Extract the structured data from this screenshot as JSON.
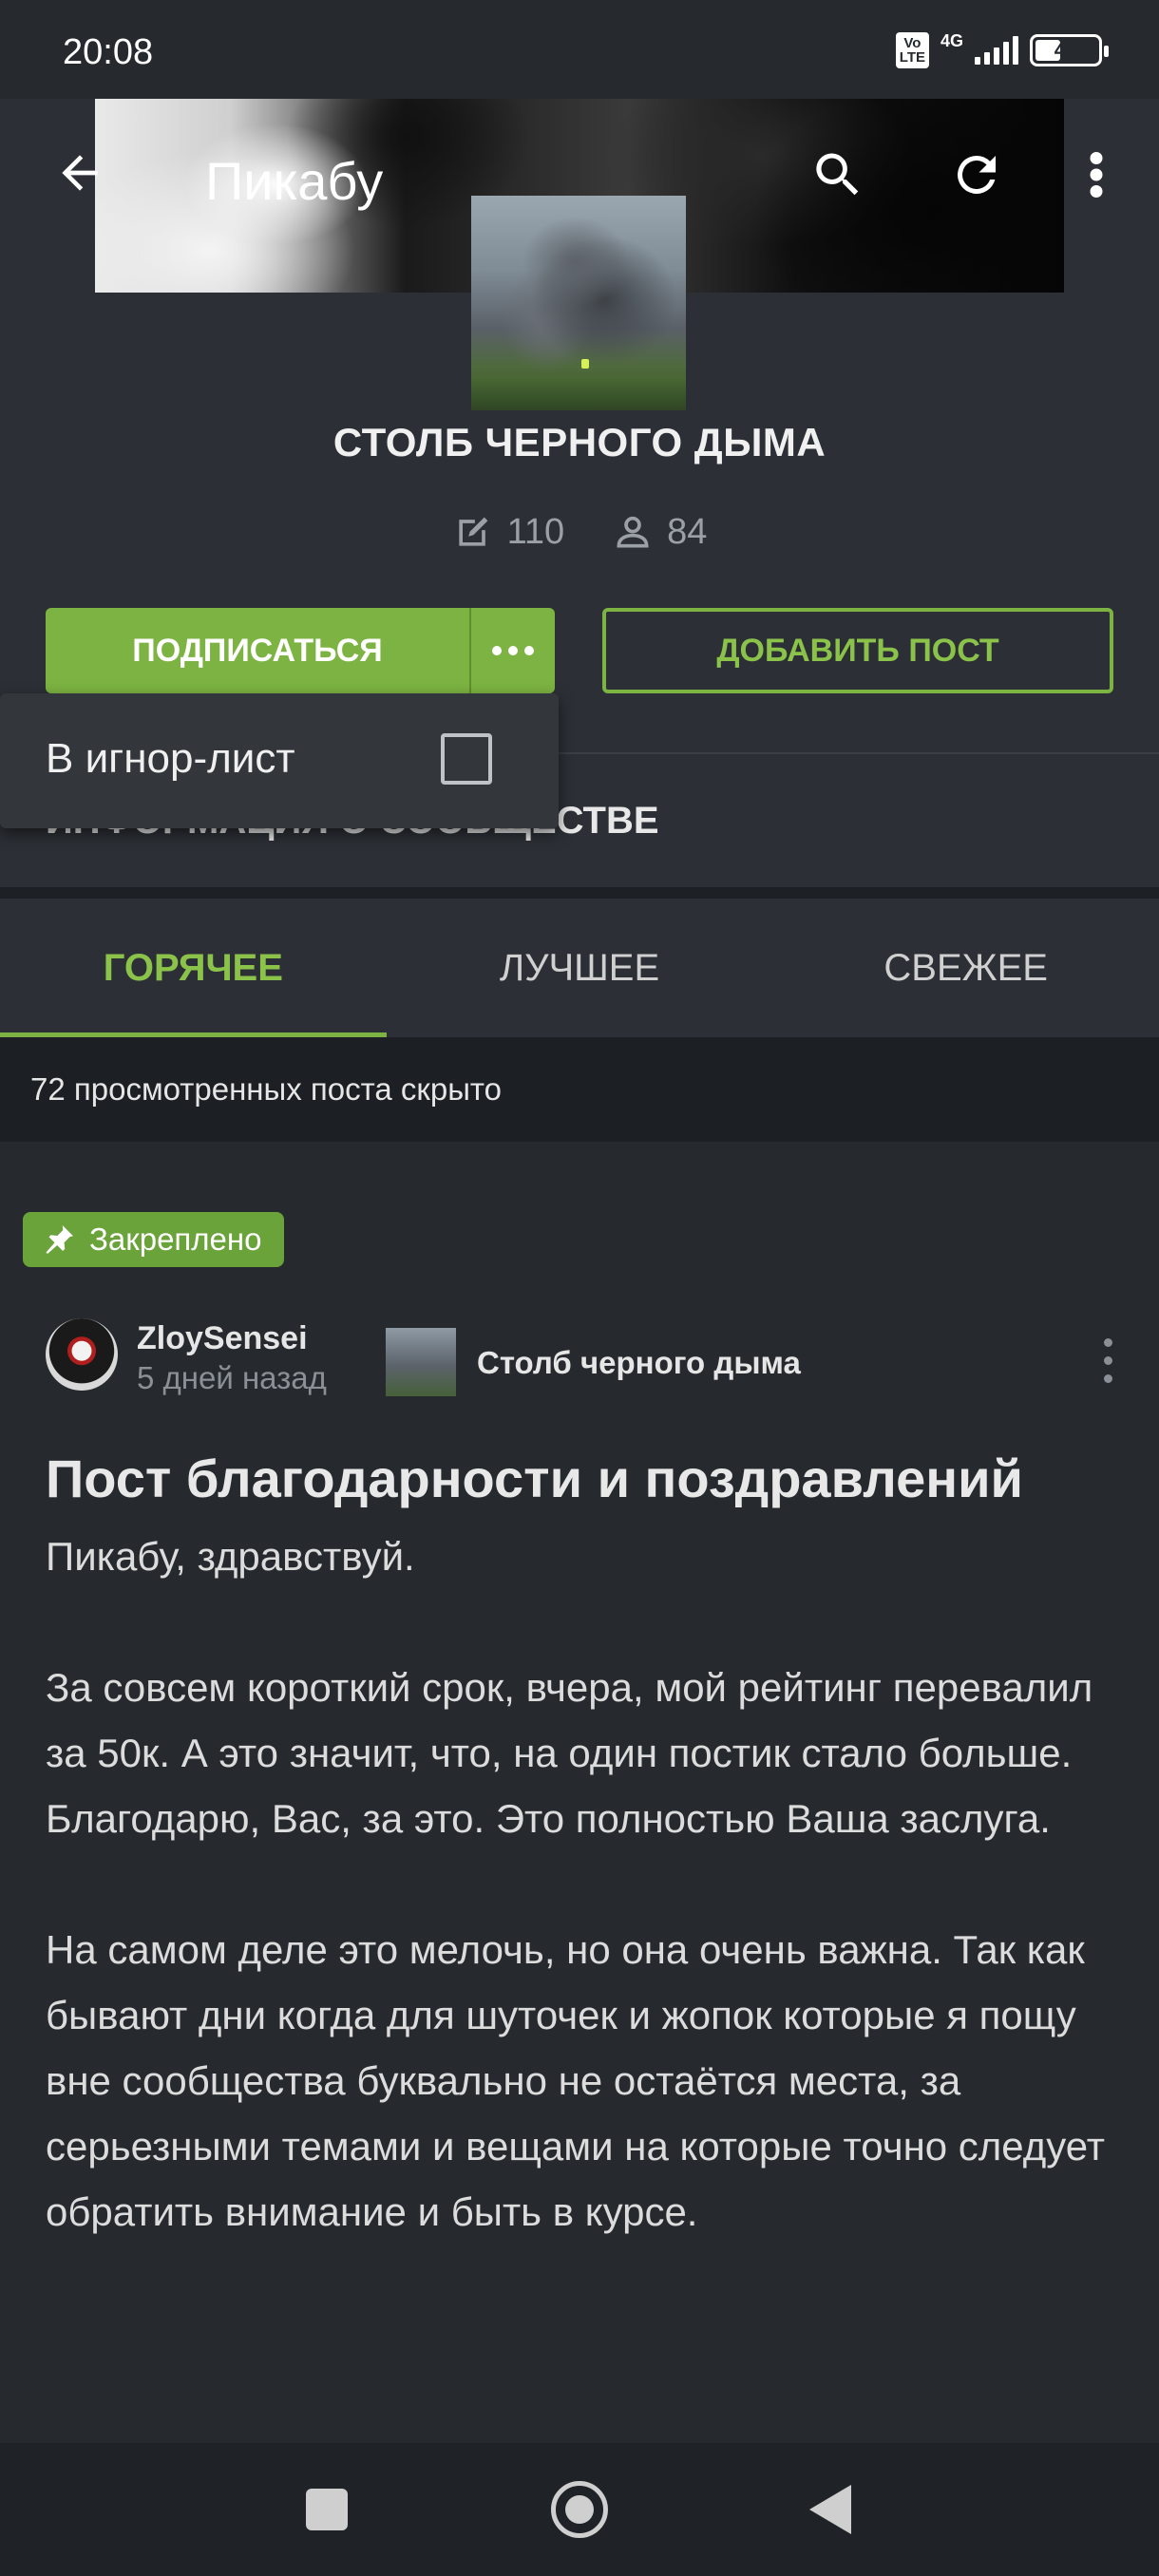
{
  "status_bar": {
    "time": "20:08",
    "volte_label": "Vo\nLTE",
    "network": "4G",
    "battery": "46",
    "battery_level": 0.46
  },
  "toolbar": {
    "title": "Пикабу",
    "back_icon": "arrow-left-icon",
    "search_icon": "search-icon",
    "refresh_icon": "refresh-icon",
    "more_icon": "more-vertical-icon"
  },
  "community": {
    "name": "СТОЛБ ЧЕРНОГО ДЫМА",
    "posts_count": "110",
    "subscribers_count": "84",
    "subscribe_label": "ПОДПИСАТЬСЯ",
    "add_post_label": "ДОБАВИТЬ ПОСТ",
    "info_label": "ИНФОРМАЦИЯ О СООБЩЕСТВЕ"
  },
  "popup": {
    "ignore_label": "В игнор-лист",
    "checked": false
  },
  "tabs": [
    {
      "label": "ГОРЯЧЕЕ",
      "active": true
    },
    {
      "label": "ЛУЧШЕЕ",
      "active": false
    },
    {
      "label": "СВЕЖЕЕ",
      "active": false
    }
  ],
  "hidden_notice": "72 просмотренных поста скрыто",
  "post": {
    "pinned_label": "Закреплено",
    "author": "ZloySensei",
    "time": "5 дней назад",
    "community": "Столб черного дыма",
    "title": "Пост благодарности и поздравлений",
    "paragraphs": [
      "Пикабу, здравствуй.",
      "За совсем короткий срок, вчера, мой рейтинг перевалил за 50к. А это значит, что, на один постик стало больше. Благодарю, Вас, за это. Это полностью Ваша заслуга.",
      "На самом деле это мелочь, но она очень важна. Так как бывают дни когда для шуточек и жопок которые я пощу вне сообщества буквально не остаётся места, за серьезными темами и вещами на которые точно следует обратить внимание и быть в курсе."
    ]
  },
  "colors": {
    "accent": "#7cb342",
    "background": "#262a2f",
    "surface": "#2c3036"
  }
}
